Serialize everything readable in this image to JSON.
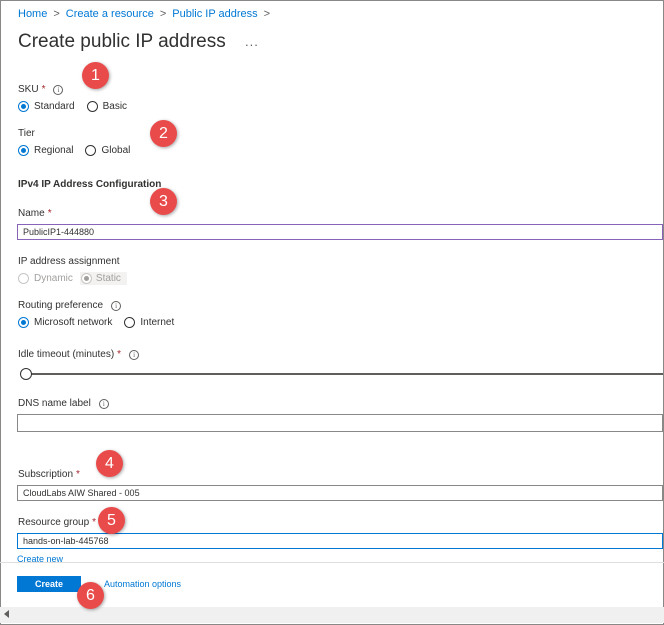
{
  "breadcrumb": [
    "Home",
    "Create a resource",
    "Public IP address"
  ],
  "breadcrumb_sep": ">",
  "page_title": "Create public IP address",
  "more_label": "...",
  "required_mark": "*",
  "info_glyph": "i",
  "sku": {
    "label": "SKU",
    "options": [
      "Standard",
      "Basic"
    ],
    "selected": "Standard"
  },
  "tier": {
    "label": "Tier",
    "options": [
      "Regional",
      "Global"
    ],
    "selected": "Regional"
  },
  "ipv4_section": "IPv4 IP Address Configuration",
  "name": {
    "label": "Name",
    "value": "PublicIP1-444880"
  },
  "ip_assignment": {
    "label": "IP address assignment",
    "options": [
      "Dynamic",
      "Static"
    ],
    "selected": "Static",
    "disabled": true
  },
  "routing": {
    "label": "Routing preference",
    "options": [
      "Microsoft network",
      "Internet"
    ],
    "selected": "Microsoft network"
  },
  "idle_timeout": {
    "label": "Idle timeout (minutes)",
    "level": 0
  },
  "dns": {
    "label": "DNS name label",
    "value": ""
  },
  "subscription": {
    "label": "Subscription",
    "value": "CloudLabs AIW Shared - 005"
  },
  "resource_group": {
    "label": "Resource group",
    "value": "hands-on-lab-445768",
    "create_new": "Create new"
  },
  "footer": {
    "create": "Create",
    "automation": "Automation options"
  },
  "annotations": [
    "1",
    "2",
    "3",
    "4",
    "5",
    "6"
  ],
  "colors": {
    "accent": "#0078d4",
    "badge": "#e94b4b",
    "required": "#a4262c"
  }
}
